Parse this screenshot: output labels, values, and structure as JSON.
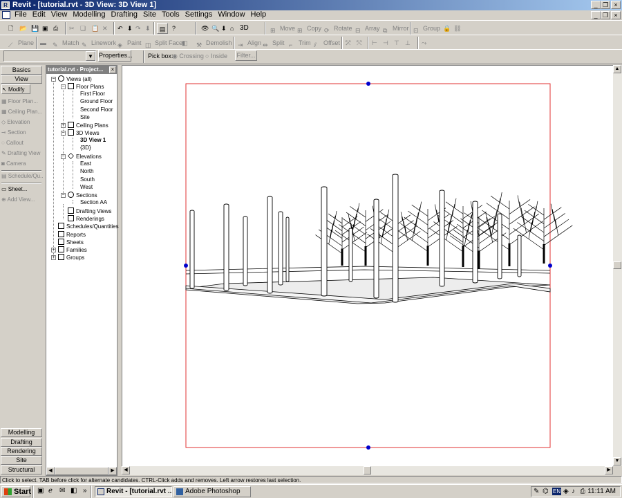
{
  "window": {
    "title": "Revit - [tutorial.rvt - 3D View: 3D View 1]"
  },
  "menu": [
    "File",
    "Edit",
    "View",
    "Modelling",
    "Drafting",
    "Site",
    "Tools",
    "Settings",
    "Window",
    "Help"
  ],
  "toolbar1": {
    "three_d_label": "3D",
    "items": [
      "Move",
      "Copy",
      "Rotate",
      "Array",
      "Mirror",
      "Group"
    ]
  },
  "toolbar2": {
    "items": [
      "Plane",
      "Match",
      "Linework",
      "Paint",
      "Split Face",
      "Demolish",
      "Align",
      "Split",
      "Trim",
      "Offset"
    ]
  },
  "toolbar3": {
    "type_selector_value": "",
    "properties_label": "Properties...",
    "pick_box_label": "Pick box:",
    "crossing_label": "Crossing",
    "inside_label": "Inside",
    "filter_label": "Filter..."
  },
  "palette": {
    "top_tabs": [
      "Basics",
      "View"
    ],
    "items": [
      "Modify",
      "Floor Plan...",
      "Ceiling Plan...",
      "Elevation",
      "Section",
      "Callout",
      "Drafting View",
      "Camera",
      "Schedule/Qu...",
      "Sheet...",
      "Add View..."
    ],
    "bottom_tabs": [
      "Modelling",
      "Drafting",
      "Rendering",
      "Site",
      "Structural"
    ]
  },
  "browser": {
    "title": "tutorial.rvt - Project...",
    "close": "×",
    "tree": {
      "root": "Views (all)",
      "floor_plans": "Floor Plans",
      "floor_plan_items": [
        "First Floor",
        "Ground Floor",
        "Second Floor",
        "Site"
      ],
      "ceiling_plans": "Ceiling Plans",
      "views_3d": "3D Views",
      "views_3d_items": [
        "3D View 1",
        "{3D}"
      ],
      "elevations": "Elevations",
      "elevation_items": [
        "East",
        "North",
        "South",
        "West"
      ],
      "sections": "Sections",
      "section_items": [
        "Section AA"
      ],
      "drafting_views": "Drafting Views",
      "renderings": "Renderings",
      "schedules": "Schedules/Quantities",
      "reports": "Reports",
      "sheets": "Sheets",
      "families": "Families",
      "groups": "Groups"
    }
  },
  "status": "Click to select. TAB before click for alternate candidates. CTRL-Click adds and removes. Left arrow restores last selection.",
  "taskbar": {
    "start": "Start",
    "tasks": [
      "Revit - [tutorial.rvt ...",
      "Adobe Photoshop"
    ],
    "lang": "EN",
    "clock": "11:11 AM"
  },
  "colors": {
    "crop_frame": "#e03030",
    "grip": "#0000cc",
    "title_bar": "#0a246a"
  }
}
